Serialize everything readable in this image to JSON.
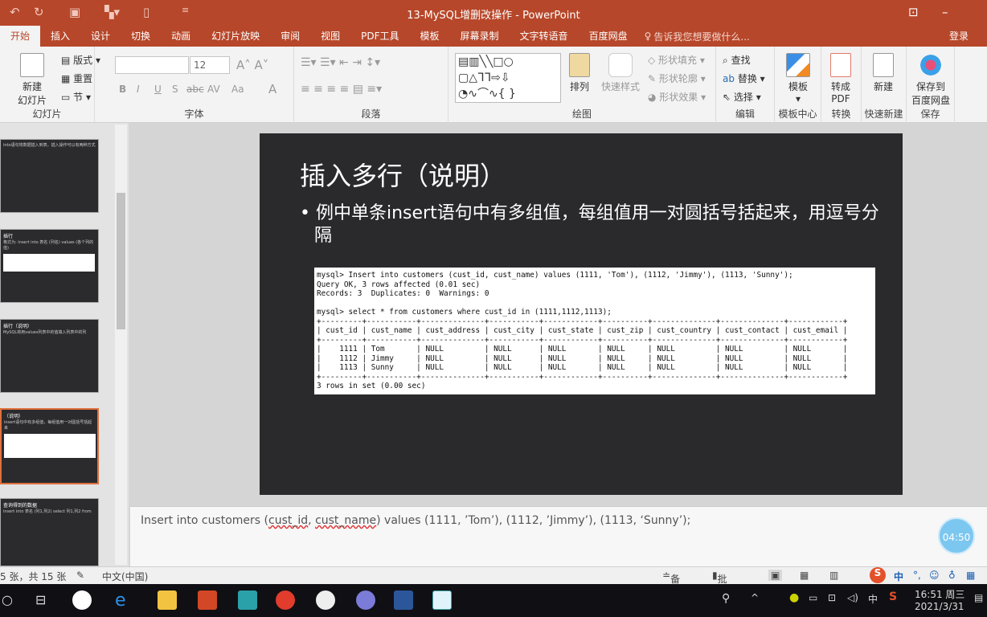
{
  "window": {
    "title": "13-MySQL增删改操作 - PowerPoint"
  },
  "quick_access": [
    "undo-icon",
    "redo-icon",
    "slideshow-icon",
    "layout-icon",
    "new-icon",
    "customize-icon"
  ],
  "tabs": [
    {
      "label": "开始",
      "active": true
    },
    {
      "label": "插入"
    },
    {
      "label": "设计"
    },
    {
      "label": "切换"
    },
    {
      "label": "动画"
    },
    {
      "label": "幻灯片放映"
    },
    {
      "label": "审阅"
    },
    {
      "label": "视图"
    },
    {
      "label": "PDF工具"
    },
    {
      "label": "模板"
    },
    {
      "label": "屏幕录制"
    },
    {
      "label": "文字转语音"
    },
    {
      "label": "百度网盘"
    }
  ],
  "tell_me": "告诉我您想要做什么...",
  "login": "登录",
  "ribbon": {
    "slides": {
      "label": "幻灯片",
      "new_slide_1": "新建",
      "new_slide_2": "幻灯片",
      "layout": "版式",
      "reset": "重置",
      "section": "节"
    },
    "font": {
      "label": "字体",
      "font_name": "",
      "font_size": "12",
      "bold": "B",
      "italic": "I",
      "underline": "U",
      "shadow": "S",
      "strike": "abc",
      "spacing": "AV",
      "case": "Aa",
      "color": "A"
    },
    "paragraph": {
      "label": "段落"
    },
    "drawing": {
      "label": "绘图",
      "arrange": "排列",
      "quick_styles": "快速样式",
      "fill": "形状填充",
      "outline": "形状轮廓",
      "effects": "形状效果"
    },
    "editing": {
      "label": "编辑",
      "find": "查找",
      "replace": "替换",
      "select": "选择"
    },
    "template": {
      "label": "模板中心",
      "btn": "模板"
    },
    "convert": {
      "label": "转换",
      "btn1": "转成",
      "btn2": "PDF"
    },
    "quicknew": {
      "label": "快速新建",
      "btn": "新建"
    },
    "save": {
      "label": "保存",
      "btn1": "保存到",
      "btn2": "百度网盘"
    }
  },
  "thumbnails": [
    {
      "title": "",
      "text": "into语句将数据插入到表，插入操作可以有两种方式"
    },
    {
      "title": "插行",
      "text": "格式为: insert into 表名 (列名) values (各个列的值)"
    },
    {
      "title": "插行（说明）",
      "text": "MySQL将用values列表中的值填入列表中的列"
    },
    {
      "title": "（说明）",
      "text": "insert语句中有多组值，每组值用一对圆括号括起来",
      "selected": true
    },
    {
      "title": "查询得到的数据",
      "text": "insert into 表名 (列1,列2) select 列1,列2 from"
    }
  ],
  "slide": {
    "title": "插入多行（说明）",
    "bullet": "例中单条insert语句中有多组值，每组值用一对圆括号括起来，用逗号分隔",
    "terminal": "mysql> Insert into customers (cust_id, cust_name) values (1111, 'Tom'), (1112, 'Jimmy'), (1113, 'Sunny');\nQuery OK, 3 rows affected (0.01 sec)\nRecords: 3  Duplicates: 0  Warnings: 0\n\nmysql> select * from customers where cust_id in (1111,1112,1113);\n+---------+-----------+--------------+-----------+------------+----------+--------------+--------------+------------+\n| cust_id | cust_name | cust_address | cust_city | cust_state | cust_zip | cust_country | cust_contact | cust_email |\n+---------+-----------+--------------+-----------+------------+----------+--------------+--------------+------------+\n|    1111 | Tom       | NULL         | NULL      | NULL       | NULL     | NULL         | NULL         | NULL       |\n|    1112 | Jimmy     | NULL         | NULL      | NULL       | NULL     | NULL         | NULL         | NULL       |\n|    1113 | Sunny     | NULL         | NULL      | NULL       | NULL     | NULL         | NULL         | NULL       |\n+---------+-----------+--------------+-----------+------------+----------+--------------+--------------+------------+\n3 rows in set (0.00 sec)"
  },
  "notes": {
    "pre": "Insert into customers (",
    "w1": "cust_id",
    "mid": ", ",
    "w2": "cust_name",
    "post": ") values (1111, ’Tom’), (1112, ’Jimmy’), (1113, ‘Sunny’);"
  },
  "recording_clock": "04:50",
  "status": {
    "slide_count": "5 张，共 15 张",
    "language": "中文(中国)",
    "notes": "备注",
    "comments": "批注"
  },
  "ime": {
    "mode": "中",
    "punct": "°,"
  },
  "taskbar": {
    "time": "16:51 周三",
    "date": "2021/3/31",
    "ime": "中"
  },
  "colors": {
    "accent": "#b7472a",
    "slide_bg": "#2a2a2d"
  }
}
